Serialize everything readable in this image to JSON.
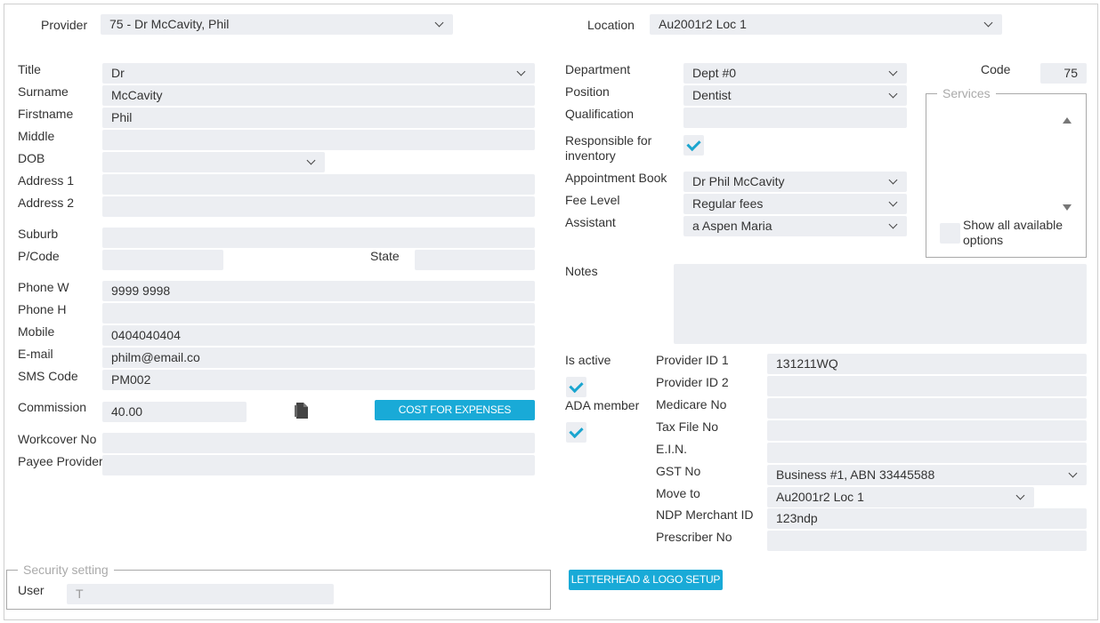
{
  "header": {
    "provider_label": "Provider",
    "provider_value": "75 - Dr McCavity, Phil",
    "location_label": "Location",
    "location_value": "Au2001r2 Loc 1"
  },
  "left": {
    "title": {
      "label": "Title",
      "value": "Dr"
    },
    "surname": {
      "label": "Surname",
      "value": "McCavity"
    },
    "firstname": {
      "label": "Firstname",
      "value": "Phil"
    },
    "middle": {
      "label": "Middle",
      "value": ""
    },
    "dob": {
      "label": "DOB",
      "value": ""
    },
    "address1": {
      "label": "Address 1",
      "value": ""
    },
    "address2": {
      "label": "Address 2",
      "value": ""
    },
    "suburb": {
      "label": "Suburb",
      "value": ""
    },
    "pcode": {
      "label": "P/Code",
      "value": ""
    },
    "state": {
      "label": "State",
      "value": ""
    },
    "phone_w": {
      "label": "Phone W",
      "value": "9999 9998"
    },
    "phone_h": {
      "label": "Phone H",
      "value": ""
    },
    "mobile": {
      "label": "Mobile",
      "value": "0404040404"
    },
    "email": {
      "label": "E-mail",
      "value": "philm@email.co"
    },
    "sms": {
      "label": "SMS Code",
      "value": "PM002"
    },
    "commission": {
      "label": "Commission",
      "value": "40.00"
    },
    "cost_button": "COST FOR EXPENSES",
    "workcover": {
      "label": "Workcover No",
      "value": ""
    },
    "payee": {
      "label": "Payee Provider",
      "value": ""
    }
  },
  "security": {
    "legend": "Security setting",
    "user_label": "User",
    "user_value": "T"
  },
  "right": {
    "department": {
      "label": "Department",
      "value": "Dept #0"
    },
    "position": {
      "label": "Position",
      "value": "Dentist"
    },
    "qualification": {
      "label": "Qualification",
      "value": ""
    },
    "responsible": {
      "label_line1": "Responsible for",
      "label_line2": "inventory",
      "checked": true
    },
    "appointment_book": {
      "label": "Appointment Book",
      "value": "Dr Phil McCavity"
    },
    "fee_level": {
      "label": "Fee Level",
      "value": "Regular fees"
    },
    "assistant": {
      "label": "Assistant",
      "value": "a Aspen Maria"
    },
    "code": {
      "label": "Code",
      "value": "75"
    },
    "services": {
      "legend": "Services",
      "show_all_line1": "Show all available",
      "show_all_line2": "options",
      "show_all_checked": false
    },
    "notes": {
      "label": "Notes",
      "value": ""
    },
    "is_active": {
      "label": "Is active",
      "checked": true
    },
    "ada_member": {
      "label": "ADA member",
      "checked": true
    },
    "provider_id1": {
      "label": "Provider ID 1",
      "value": "131211WQ"
    },
    "provider_id2": {
      "label": "Provider ID 2",
      "value": ""
    },
    "medicare": {
      "label": "Medicare No",
      "value": ""
    },
    "tax_file": {
      "label": "Tax File No",
      "value": ""
    },
    "ein": {
      "label": "E.I.N.",
      "value": ""
    },
    "gst": {
      "label": "GST No",
      "value": "Business #1, ABN 33445588"
    },
    "move_to": {
      "label": "Move to",
      "value": "Au2001r2 Loc 1"
    },
    "ndp": {
      "label": "NDP Merchant ID",
      "value": "123ndp"
    },
    "prescriber": {
      "label": "Prescriber No",
      "value": ""
    },
    "letterhead_button": "LETTERHEAD & LOGO SETUP"
  },
  "colors": {
    "accent": "#19aad7",
    "field_bg": "#eceef2",
    "border": "#a9a9a9"
  },
  "icons": {
    "commission_icon": "document-icon"
  }
}
